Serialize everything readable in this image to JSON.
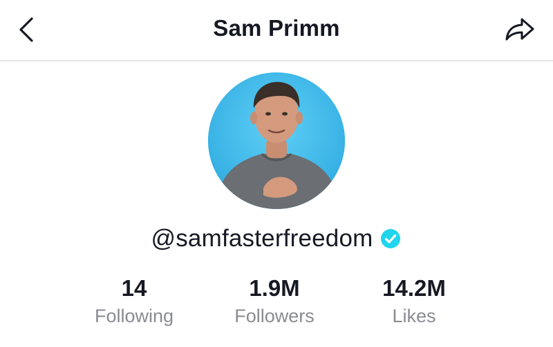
{
  "header": {
    "title": "Sam Primm",
    "back_icon": "chevron-left-icon",
    "share_icon": "share-arrow-icon"
  },
  "profile": {
    "avatar_bg_color": "#4fc3ee",
    "username": "@samfasterfreedom",
    "verified": true,
    "verified_color": "#20d5ec"
  },
  "stats": [
    {
      "value": "14",
      "label": "Following"
    },
    {
      "value": "1.9M",
      "label": "Followers"
    },
    {
      "value": "14.2M",
      "label": "Likes"
    }
  ]
}
